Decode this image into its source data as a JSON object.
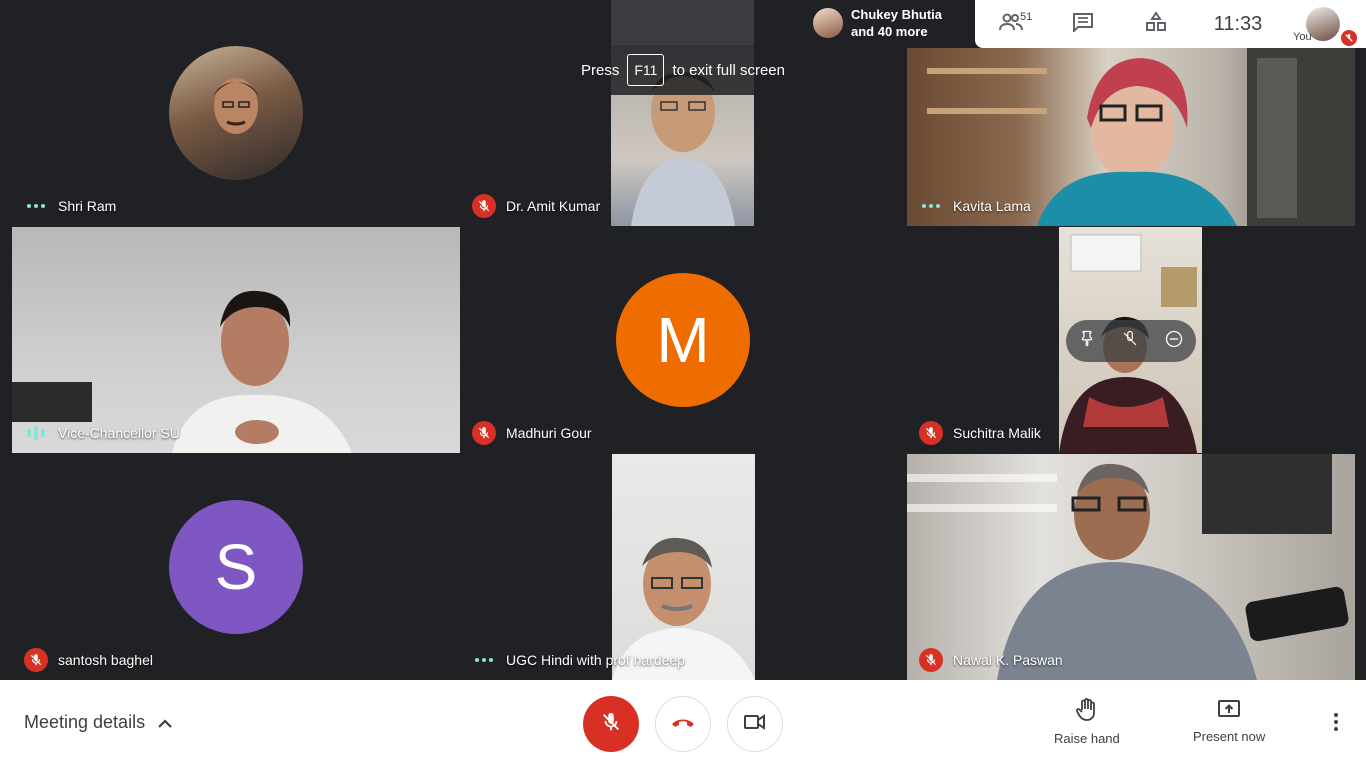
{
  "fullscreen_toast": {
    "press": "Press",
    "key": "F11",
    "suffix": "to exit full screen"
  },
  "participants_pill": {
    "line1": "Chukey Bhutia",
    "line2": "and 40 more"
  },
  "topbar": {
    "participant_count": "51",
    "time": "11:33",
    "you_label": "You"
  },
  "tiles": [
    {
      "name": "Shri Ram",
      "audio": "speaking-dots"
    },
    {
      "name": "Dr. Amit Kumar",
      "audio": "muted"
    },
    {
      "name": "Kavita Lama",
      "audio": "speaking-dots"
    },
    {
      "name": "Vice-Chancellor SU",
      "audio": "speaking-bars"
    },
    {
      "name": "Madhuri Gour",
      "audio": "muted",
      "initial": "M",
      "color": "#ef6c00"
    },
    {
      "name": "Suchitra Malik",
      "audio": "muted"
    },
    {
      "name": "santosh baghel",
      "audio": "muted",
      "initial": "S",
      "color": "#7e57c2"
    },
    {
      "name": "UGC Hindi with prof hardeep",
      "audio": "speaking-dots"
    },
    {
      "name": "Nawal K. Paswan",
      "audio": "muted"
    }
  ],
  "bottombar": {
    "meeting_details": "Meeting details",
    "raise_hand": "Raise hand",
    "present_now": "Present now"
  },
  "colors": {
    "accent_red": "#d93025",
    "dots": "#8ae3d7",
    "bg": "#202124"
  }
}
